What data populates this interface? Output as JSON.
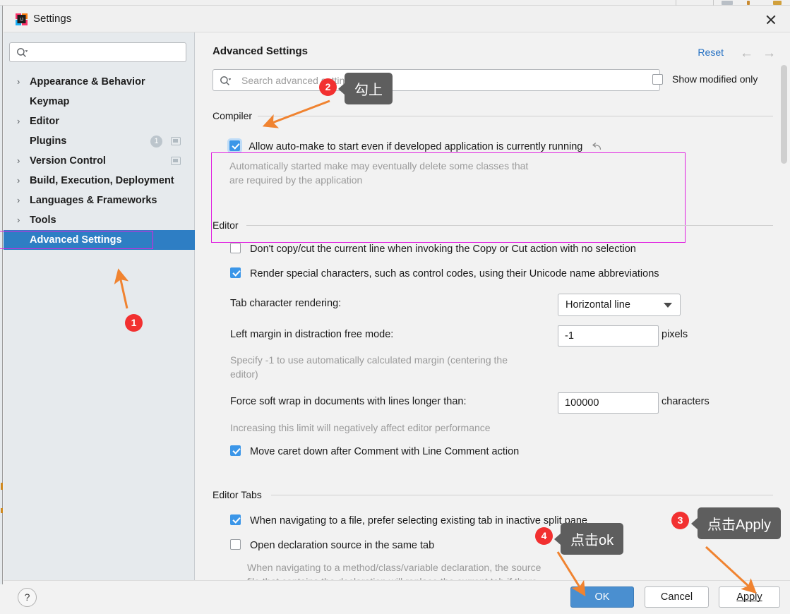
{
  "window": {
    "title": "Settings",
    "close_icon": "close-icon",
    "app_icon": "intellij-idea-logo"
  },
  "sidebar": {
    "search_placeholder": "",
    "search_icon": "search-icon",
    "items": [
      {
        "label": "Appearance & Behavior",
        "expandable": true,
        "selected": false
      },
      {
        "label": "Keymap",
        "expandable": false,
        "selected": false
      },
      {
        "label": "Editor",
        "expandable": true,
        "selected": false
      },
      {
        "label": "Plugins",
        "expandable": false,
        "selected": false,
        "badge": "1",
        "has_ext_icon": true
      },
      {
        "label": "Version Control",
        "expandable": true,
        "selected": false,
        "has_ext_icon": true
      },
      {
        "label": "Build, Execution, Deployment",
        "expandable": true,
        "selected": false
      },
      {
        "label": "Languages & Frameworks",
        "expandable": true,
        "selected": false
      },
      {
        "label": "Tools",
        "expandable": true,
        "selected": false
      },
      {
        "label": "Advanced Settings",
        "expandable": false,
        "selected": true
      }
    ]
  },
  "content": {
    "title": "Advanced Settings",
    "reset_label": "Reset",
    "back_arrow": "←",
    "forward_arrow": "→",
    "search": {
      "placeholder": "Search advanced settings",
      "value": "",
      "icon": "search-icon"
    },
    "show_modified_only": {
      "label": "Show modified only",
      "checked": false
    },
    "sections": [
      {
        "name": "compiler",
        "label": "Compiler",
        "options": [
          {
            "label": "Allow auto-make to start even if developed application is currently running",
            "checked": true,
            "focused": true,
            "revert_icon": "revert-arrow-icon",
            "description_lines": [
              "Automatically started make may eventually delete some classes that",
              "are required by the application"
            ]
          }
        ]
      },
      {
        "name": "editor",
        "label": "Editor",
        "options": [
          {
            "label": "Don't copy/cut the current line when invoking the Copy or Cut action with no selection",
            "checked": false
          },
          {
            "label": "Render special characters, such as control codes, using their Unicode name abbreviations",
            "checked": true
          }
        ],
        "fields": [
          {
            "label": "Tab character rendering:",
            "type": "combo",
            "value": "Horizontal line",
            "unit": ""
          },
          {
            "label": "Left margin in distraction free mode:",
            "type": "text",
            "value": "-1",
            "unit": "pixels",
            "description_lines": [
              "Specify -1 to use automatically calculated margin (centering the",
              "editor)"
            ]
          },
          {
            "label": "Force soft wrap in documents with lines longer than:",
            "type": "text",
            "value": "100000",
            "unit": "characters",
            "description_lines": [
              "Increasing this limit will negatively affect editor performance"
            ]
          }
        ],
        "trailing_options": [
          {
            "label": "Move caret down after Comment with Line Comment action",
            "checked": true
          }
        ]
      },
      {
        "name": "editor-tabs",
        "label": "Editor Tabs",
        "options": [
          {
            "label": "When navigating to a file, prefer selecting existing tab in inactive split pane",
            "checked": true
          },
          {
            "label": "Open declaration source in the same tab",
            "checked": false,
            "description_lines": [
              "When navigating to a method/class/variable declaration, the source",
              "file that contains the declaration will replace the current tab if there"
            ]
          }
        ]
      }
    ]
  },
  "footer": {
    "help_label": "?",
    "ok_label": "OK",
    "cancel_label": "Cancel",
    "apply_label": "Apply"
  },
  "annotations": {
    "markers": [
      {
        "id": "1",
        "number": "1"
      },
      {
        "id": "2",
        "number": "2"
      },
      {
        "id": "3",
        "number": "3"
      },
      {
        "id": "4",
        "number": "4"
      }
    ],
    "tooltips": [
      {
        "id": "tip-2",
        "text": "勾上"
      },
      {
        "id": "tip-3",
        "text": "点击Apply"
      },
      {
        "id": "tip-4",
        "text": "点击ok"
      }
    ],
    "arrow_color": "#f08330",
    "highlight_color": "#e01fe0",
    "marker_color": "#f23030"
  }
}
